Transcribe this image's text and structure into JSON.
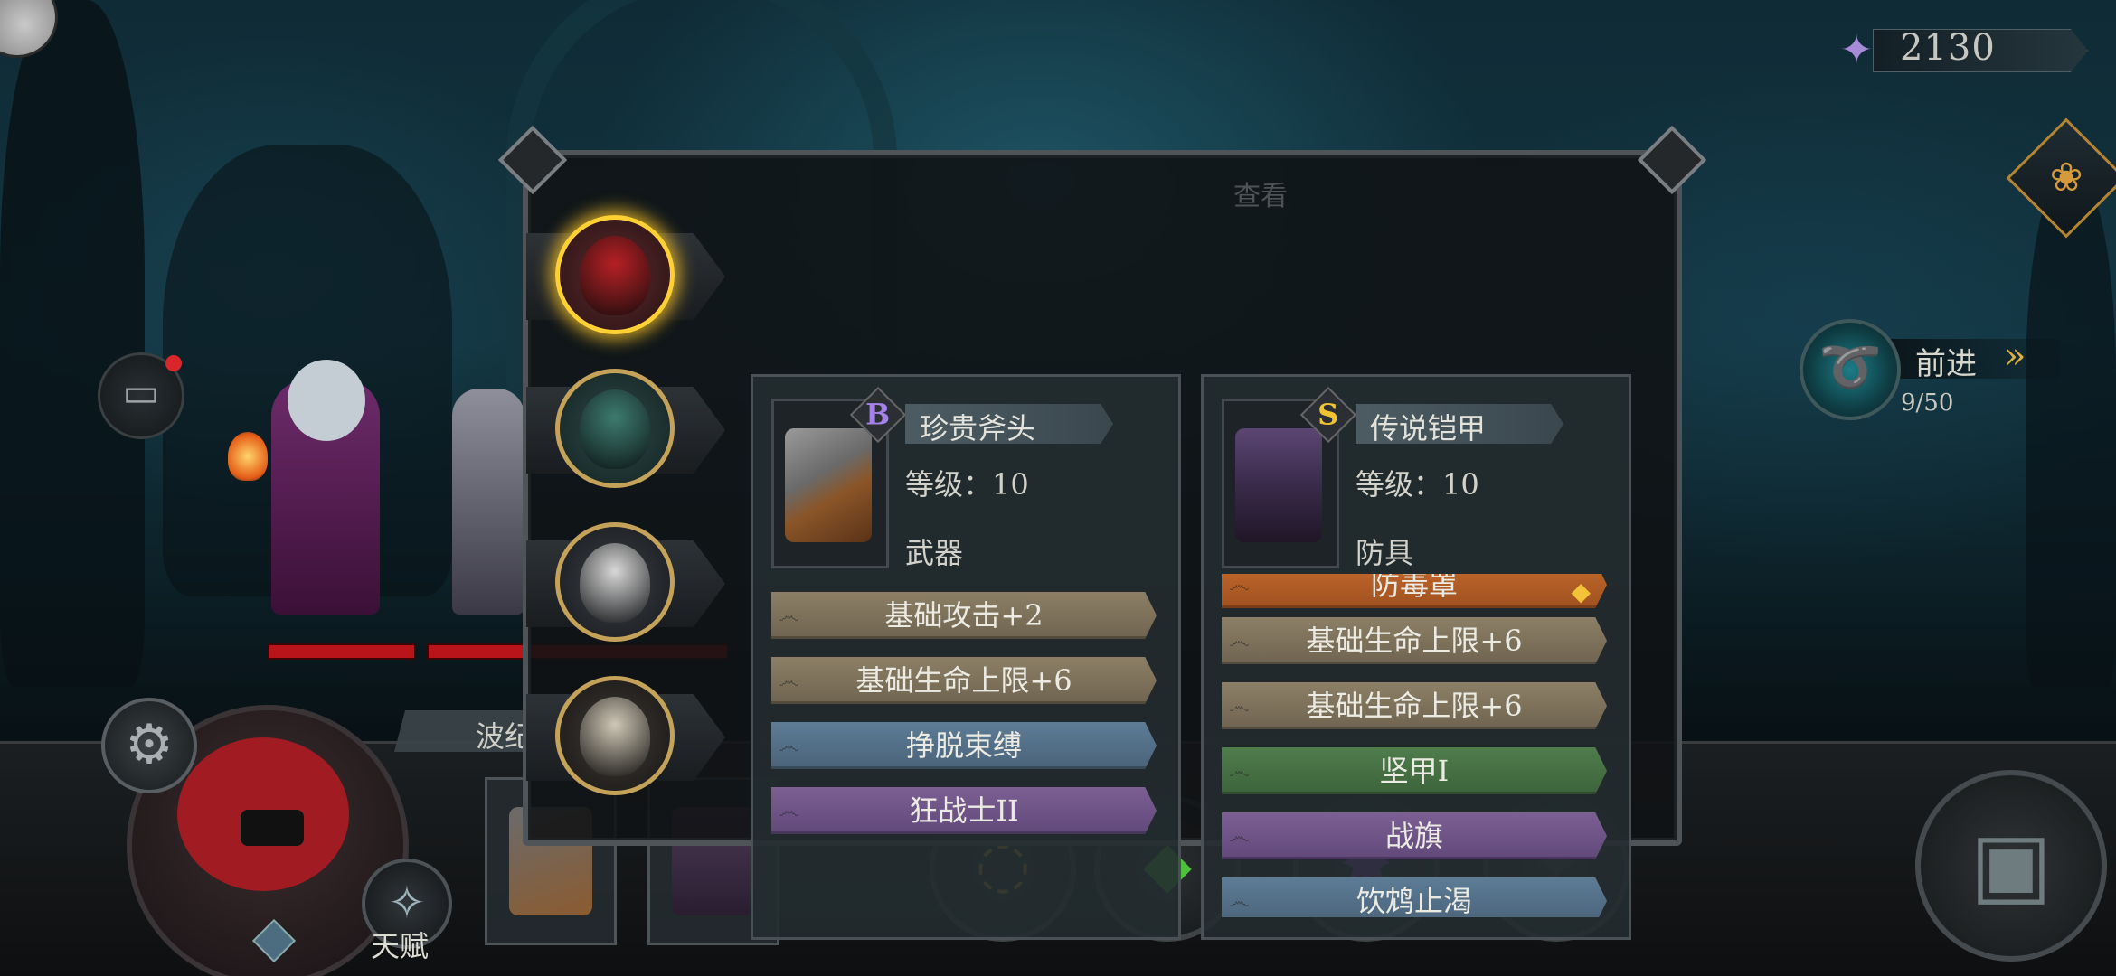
{
  "currency": {
    "icon": "soul-shard-icon",
    "value": "2130"
  },
  "dialog": {
    "title": "查看"
  },
  "advance": {
    "label": "前进",
    "progress": "9/50"
  },
  "heroes": [
    {
      "name": "red-hair-masked-heroine",
      "active": true,
      "color": "#b52024"
    },
    {
      "name": "green-spirit-hero",
      "active": false,
      "color": "#3c7a6f"
    },
    {
      "name": "white-hat-witch",
      "active": false,
      "color": "#d8d8d8"
    },
    {
      "name": "silver-hair-knight",
      "active": false,
      "color": "#cfc7b6"
    }
  ],
  "left_item": {
    "rank": "B",
    "rank_color": "#a582ea",
    "name": "珍贵斧头",
    "level": "等级：10",
    "type": "武器",
    "affixes": [
      {
        "text": "基础攻击+2",
        "color": "tan"
      },
      {
        "text": "基础生命上限+6",
        "color": "tan"
      },
      {
        "text": "挣脱束缚",
        "color": "blue"
      },
      {
        "text": "狂战士II",
        "color": "purple"
      }
    ]
  },
  "right_item": {
    "rank": "S",
    "rank_color": "#f0c431",
    "name": "传说铠甲",
    "level": "等级：10",
    "type": "防具",
    "affixes": [
      {
        "text": "防毒罩",
        "color": "orange",
        "gem": true
      },
      {
        "text": "基础生命上限+6",
        "color": "tan"
      },
      {
        "text": "基础生命上限+6",
        "color": "tan"
      },
      {
        "text": "坚甲I",
        "color": "green"
      },
      {
        "text": "战旗",
        "color": "purple"
      },
      {
        "text": "饮鸩止渴",
        "color": "blue"
      }
    ]
  },
  "bottom": {
    "wave_label": "波纪",
    "talent_label": "天赋"
  }
}
